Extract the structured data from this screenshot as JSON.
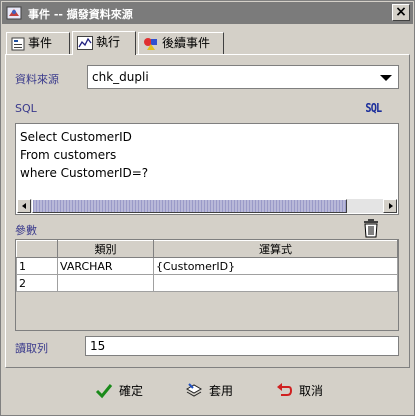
{
  "window": {
    "title": "事件 -- 擷發資料來源",
    "close_label": "×"
  },
  "tabs": [
    {
      "label": "事件",
      "icon": "form-icon"
    },
    {
      "label": "執行",
      "icon": "chart-icon"
    },
    {
      "label": "後續事件",
      "icon": "shapes-icon"
    }
  ],
  "datasource": {
    "label": "資料來源",
    "value": "chk_dupli"
  },
  "sql": {
    "label": "SQL",
    "icon_text": "SQL",
    "lines": [
      "Select CustomerID",
      "From customers",
      "where CustomerID=?"
    ]
  },
  "params": {
    "label": "參數",
    "columns": [
      "類別",
      "運算式"
    ],
    "rows": [
      {
        "num": "1",
        "type": "VARCHAR",
        "expr": "{CustomerID}"
      },
      {
        "num": "2",
        "type": "",
        "expr": ""
      }
    ]
  },
  "read_rows": {
    "label": "讀取列",
    "value": "15"
  },
  "buttons": {
    "ok": "確定",
    "apply": "套用",
    "cancel": "取消"
  },
  "colors": {
    "titlebar": "#7b7b7b",
    "label": "#3a3a8c",
    "sql_icon": "#1a2d9b",
    "scroll_thumb": "#b8b8d8"
  }
}
